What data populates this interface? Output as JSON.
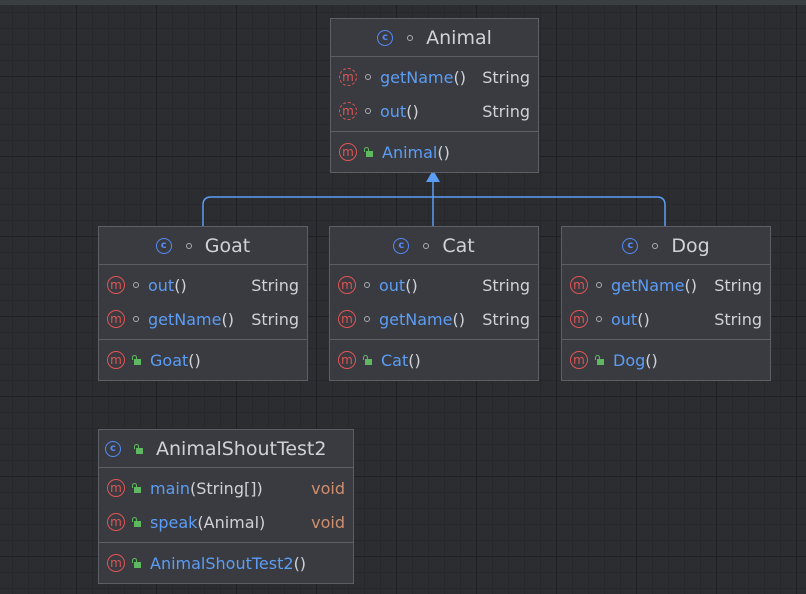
{
  "classes": {
    "animal": {
      "name": "Animal",
      "methods": [
        {
          "name": "getName",
          "params": "()",
          "type": "String"
        },
        {
          "name": "out",
          "params": "()",
          "type": "String"
        }
      ],
      "ctor": {
        "name": "Animal",
        "params": "()"
      }
    },
    "goat": {
      "name": "Goat",
      "methods": [
        {
          "name": "out",
          "params": "()",
          "type": "String"
        },
        {
          "name": "getName",
          "params": "()",
          "type": "String"
        }
      ],
      "ctor": {
        "name": "Goat",
        "params": " ()"
      }
    },
    "cat": {
      "name": "Cat",
      "methods": [
        {
          "name": "out",
          "params": "()",
          "type": "String"
        },
        {
          "name": "getName",
          "params": "()",
          "type": "String"
        }
      ],
      "ctor": {
        "name": "Cat",
        "params": " ()"
      }
    },
    "dog": {
      "name": "Dog",
      "methods": [
        {
          "name": "getName",
          "params": "()",
          "type": "String"
        },
        {
          "name": "out",
          "params": "()",
          "type": "String"
        }
      ],
      "ctor": {
        "name": "Dog",
        "params": "()"
      }
    },
    "test": {
      "name": "AnimalShoutTest2",
      "methods": [
        {
          "name": "main",
          "params": "(String[])",
          "type": "void"
        },
        {
          "name": "speak",
          "params": "(Animal)",
          "type": "void"
        }
      ],
      "ctor": {
        "name": "AnimalShoutTest2",
        "params": "()"
      }
    }
  },
  "icons": {
    "class": "c",
    "method": "m"
  },
  "colors": {
    "background": "#2b2d30",
    "node": "#393b40",
    "border": "#5c5f66",
    "class_icon": "#548af7",
    "method_icon": "#e05555",
    "method_name": "#5c9df5",
    "void_type": "#cf8e6d",
    "edge": "#5c9df5"
  }
}
